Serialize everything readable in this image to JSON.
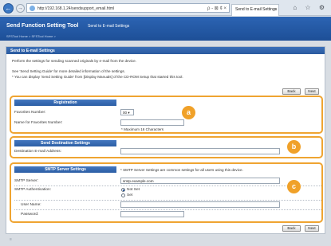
{
  "browser": {
    "url": "http://192.168.1.24/sendsupport_email.html",
    "tab_title": "Send to E-mail Settings",
    "back_icon": "arrow-left-icon",
    "forward_icon": "arrow-right-icon",
    "address_tools": "ρ - ⊠ ¢ ×",
    "chrome_icons": "⌂ ☆ ⚙"
  },
  "app": {
    "title": "Send Function Setting Tool",
    "header_crumb": "Send to E-mail Settings",
    "breadcrumbs": "SFSTool Home  >  SFSTool Home  >"
  },
  "page": {
    "title": "Send to E-mail Settings",
    "desc1": "Perform the settings for sending scanned originals by e-mail from the device.",
    "desc2": "See 'Send Setting Guide' for more detailed information of the settings.",
    "desc3": "* You can display 'Send Setting Guide' from [Display Manuals] of the CD-ROM Setup that started this tool.",
    "back_label": "Back",
    "next_label": "Next"
  },
  "registration": {
    "header": "Registration",
    "favorites_number_label": "Favorites Number:",
    "favorites_number_value": "00",
    "favorites_name_label": "Name for Favorites Number:",
    "favorites_name_value": "",
    "max_note": "* Maximum 16 Characters",
    "badge": "a"
  },
  "destination": {
    "header": "Send Destination Settings",
    "email_label": "Destination E-mail Address:",
    "email_value": "",
    "badge": "b"
  },
  "smtp": {
    "header": "SMTP Server Settings",
    "note": "* SMTP Server Settings are common settings for all users using this device.",
    "server_label": "SMTP Server:",
    "server_value": "smtp.example.com",
    "auth_label": "SMTP Authentication:",
    "auth_options": [
      "Not Set",
      "Set"
    ],
    "auth_selected": "Not Set",
    "username_label": "User Name:",
    "username_value": "",
    "password_label": "Password:",
    "password_value": "",
    "badge": "c"
  }
}
